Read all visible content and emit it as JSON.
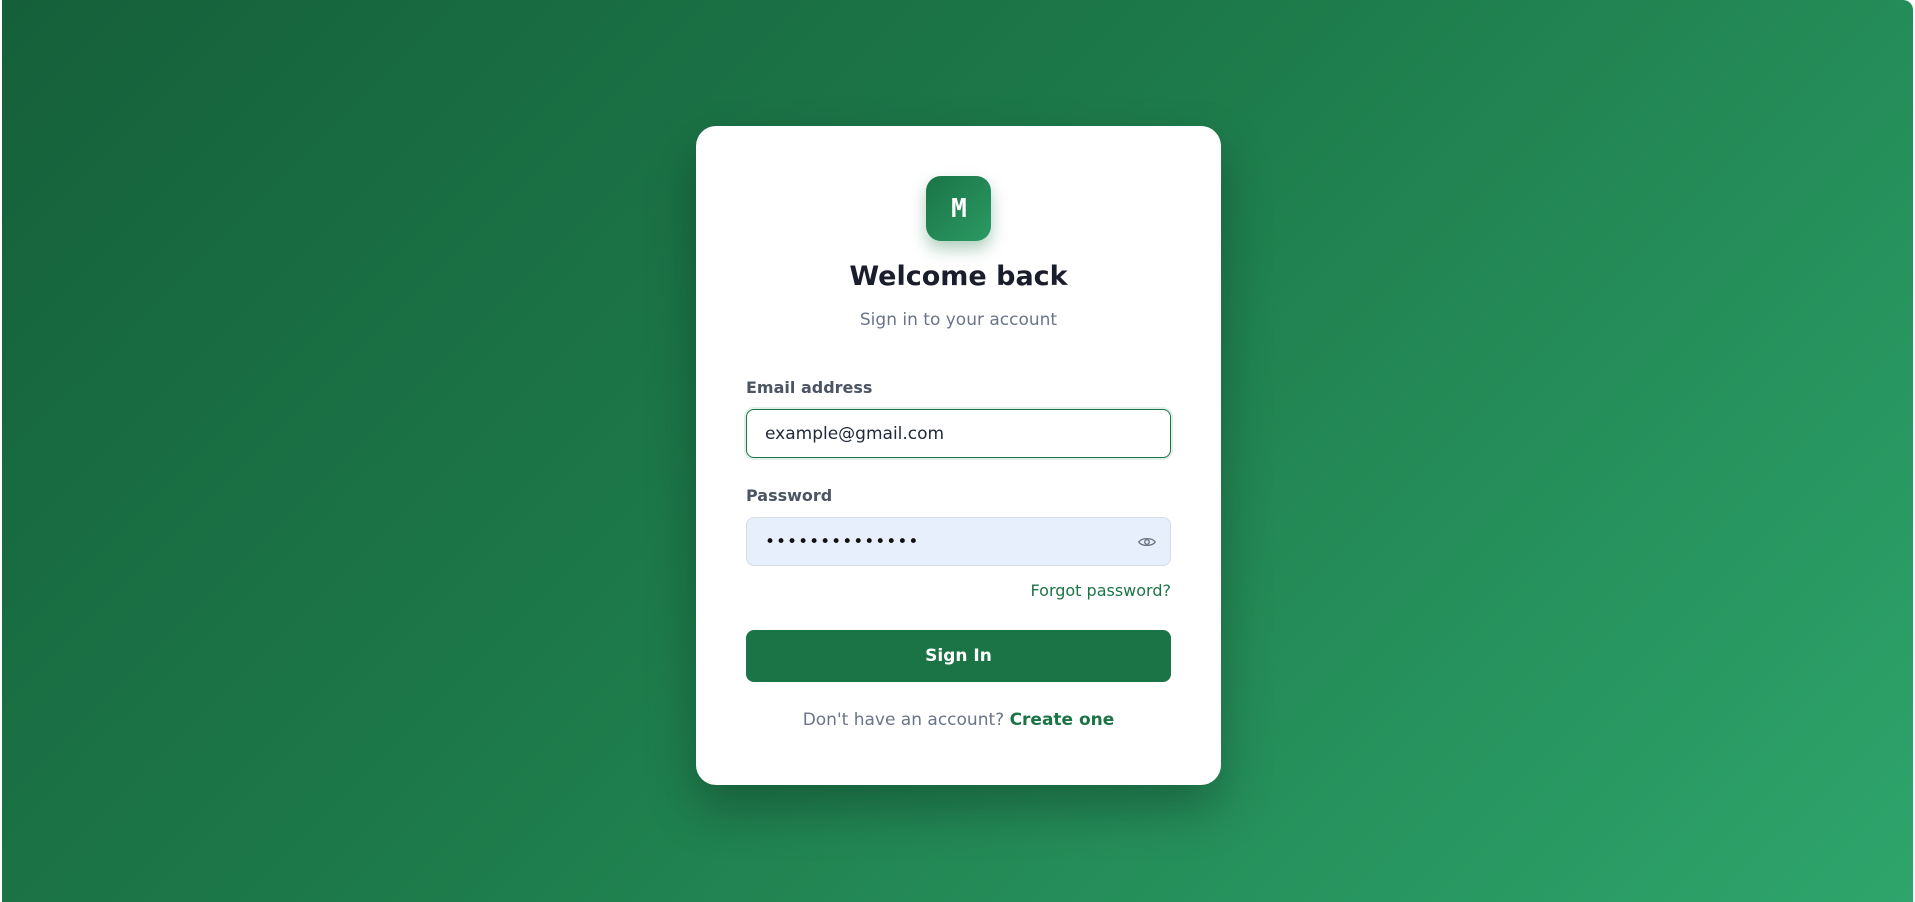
{
  "brand": {
    "logo_letter": "M",
    "accent_color": "#1b7446"
  },
  "header": {
    "title": "Welcome back",
    "subtitle": "Sign in to your account"
  },
  "form": {
    "email": {
      "label": "Email address",
      "value": "example@gmail.com"
    },
    "password": {
      "label": "Password",
      "masked_value": "••••••••••••••",
      "toggle_icon": "eye-icon"
    },
    "forgot_label": "Forgot password?",
    "submit_label": "Sign In"
  },
  "footer": {
    "prompt": "Don't have an account?",
    "link_label": "Create one"
  }
}
